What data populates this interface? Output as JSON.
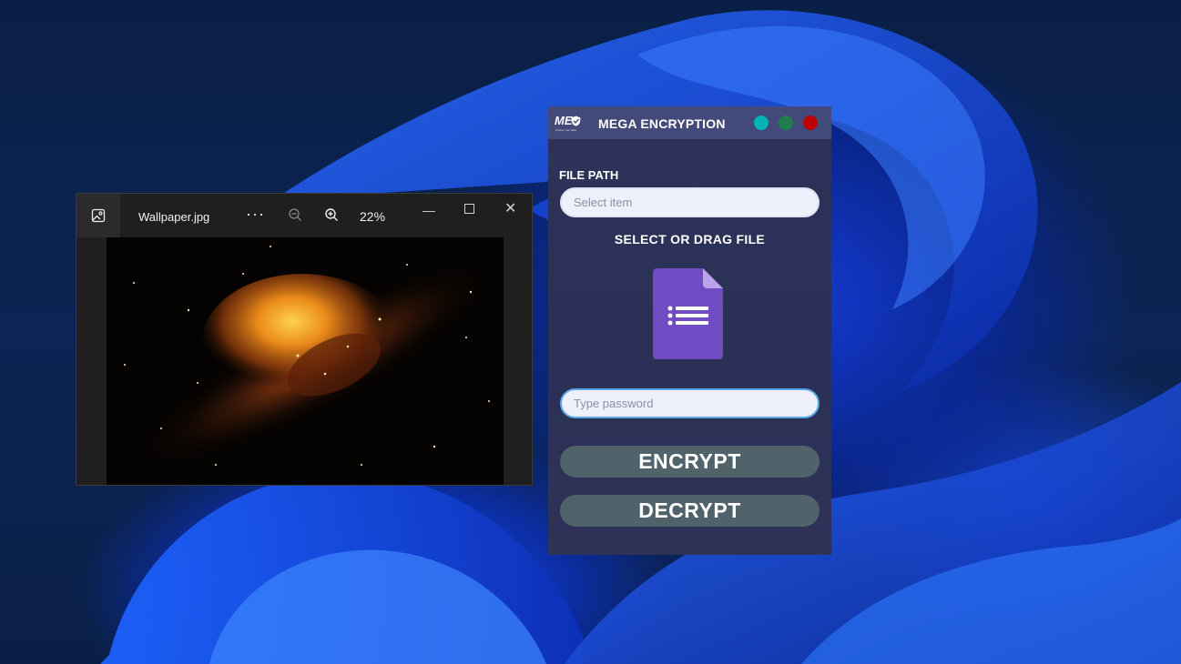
{
  "viewer": {
    "file_name": "Wallpaper.jpg",
    "more_label": "···",
    "zoom_level": "22%"
  },
  "mega": {
    "title": "MEGA ENCRYPTION",
    "logo_text": "ME",
    "logo_tagline": "Protect your data",
    "file_path_label": "FILE PATH",
    "file_path_placeholder": "Select item",
    "select_label": "SELECT OR DRAG FILE",
    "password_placeholder": "Type password",
    "encrypt_label": "ENCRYPT",
    "decrypt_label": "DECRYPT",
    "colors": {
      "teal": "#00b4b4",
      "green": "#1f7f4f",
      "red": "#c00000",
      "doc_purple": "#6f4cc3"
    }
  }
}
